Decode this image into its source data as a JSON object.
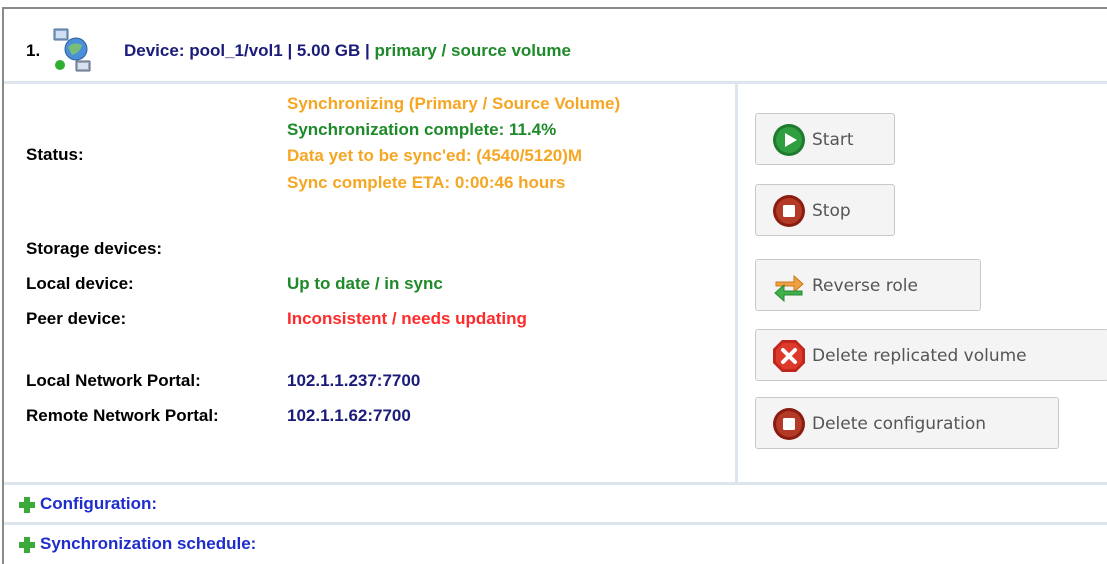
{
  "header": {
    "index": "1.",
    "device_label": "Device: pool_1/vol1 | 5.00 GB |",
    "role": "primary / source volume"
  },
  "status": {
    "label": "Status:",
    "state": "Synchronizing (Primary / Source Volume)",
    "complete": "Synchronization complete: 11.4%",
    "remaining": "Data yet to be sync'ed: (4540/5120)M",
    "eta": "Sync complete ETA: 0:00:46 hours"
  },
  "storage": {
    "heading": "Storage devices:",
    "local_label": "Local device:",
    "local_value": "Up to date / in sync",
    "peer_label": "Peer device:",
    "peer_value": "Inconsistent / needs updating"
  },
  "network": {
    "local_label": "Local Network Portal:",
    "local_value": "102.1.1.237:7700",
    "remote_label": "Remote Network Portal:",
    "remote_value": "102.1.1.62:7700"
  },
  "actions": {
    "start": "Start",
    "stop": "Stop",
    "reverse_role": "Reverse role",
    "delete_volume": "Delete replicated volume",
    "delete_config": "Delete configuration"
  },
  "sections": {
    "configuration": "Configuration:",
    "schedule": "Synchronization schedule:"
  },
  "colors": {
    "navy": "#1b1b7a",
    "green": "#1e8a2a",
    "orange": "#f5a623",
    "red": "#ff2a2a",
    "link_blue": "#1f2dcc"
  },
  "icons": {
    "device": "replication-device-icon",
    "start": "play-icon",
    "stop": "stop-icon",
    "reverse": "reverse-arrows-icon",
    "delete": "delete-x-icon",
    "plus": "plus-icon"
  }
}
